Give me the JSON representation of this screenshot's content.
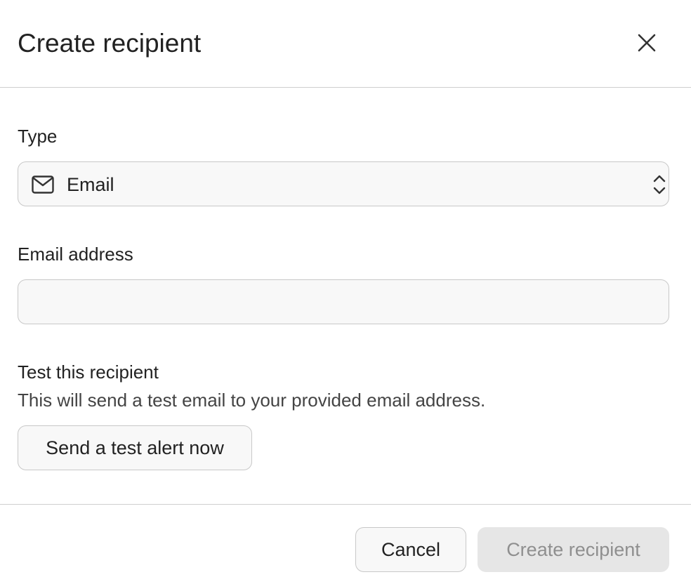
{
  "dialog": {
    "title": "Create recipient",
    "close_icon": "close-icon"
  },
  "type_field": {
    "label": "Type",
    "selected_value": "Email",
    "leading_icon": "mail-icon",
    "trailing_icon": "chevron-up-down-icon"
  },
  "email_field": {
    "label": "Email address",
    "value": "",
    "placeholder": ""
  },
  "test_section": {
    "heading": "Test this recipient",
    "description": "This will send a test email to your provided email address.",
    "button_label": "Send a test alert now"
  },
  "footer": {
    "cancel_label": "Cancel",
    "create_label": "Create recipient",
    "create_disabled": true
  },
  "colors": {
    "border": "#c8c8c8",
    "field_background": "#f8f8f8",
    "disabled_button_background": "#e6e6e6",
    "disabled_button_text": "#8f8f8f",
    "text": "#222222"
  }
}
